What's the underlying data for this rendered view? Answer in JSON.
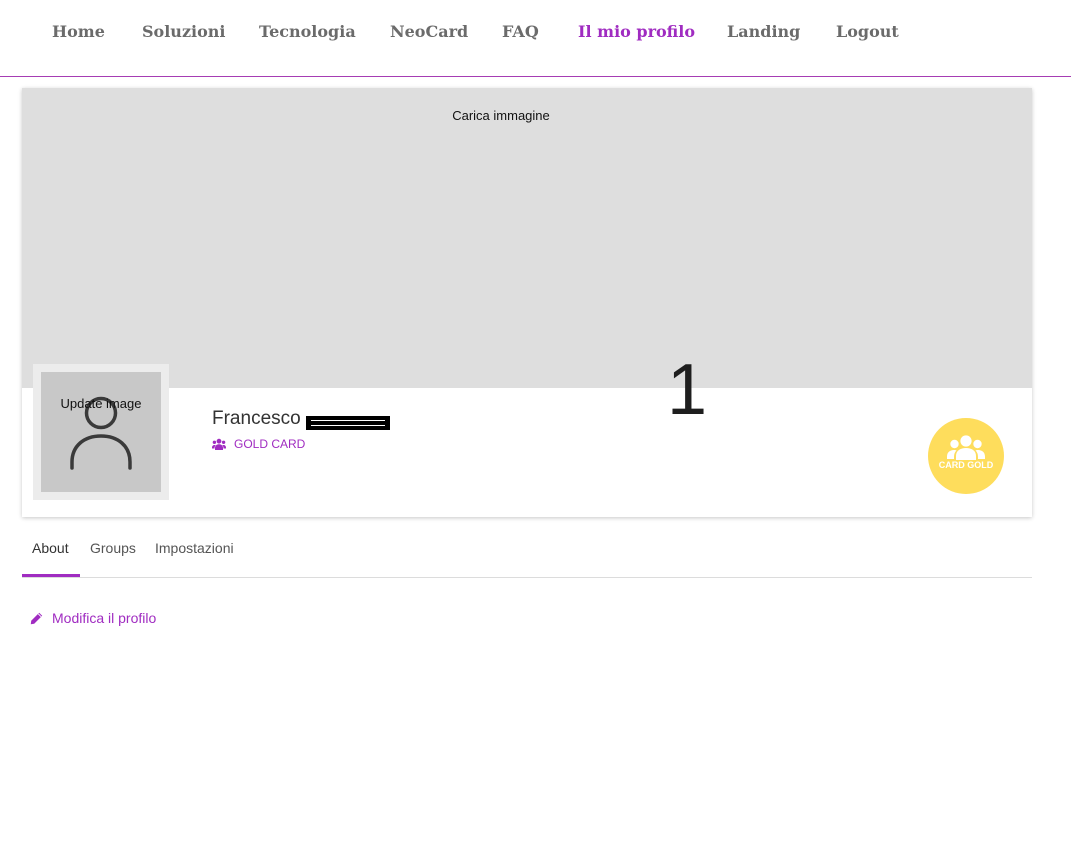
{
  "nav": {
    "items": [
      {
        "label": "Home"
      },
      {
        "label": "Soluzioni"
      },
      {
        "label": "Tecnologia"
      },
      {
        "label": "NeoCard"
      },
      {
        "label": "FAQ"
      },
      {
        "label": "Il mio profilo",
        "active": true
      },
      {
        "label": "Landing"
      },
      {
        "label": "Logout"
      }
    ]
  },
  "profile": {
    "cover_upload_label": "Carica immagine",
    "counter": "1",
    "avatar_update_label": "Update image",
    "avatar_icon": "user-icon",
    "name": "Francesco",
    "name_redacted": true,
    "card_level_icon": "users-icon",
    "card_level": "GOLD CARD",
    "badge": {
      "icon": "users-icon",
      "label": "CARD GOLD",
      "color": "#fedd5c"
    }
  },
  "tabs": [
    {
      "label": "About",
      "active": true
    },
    {
      "label": "Groups"
    },
    {
      "label": "Impostazioni"
    }
  ],
  "actions": {
    "edit_icon": "pencil-icon",
    "edit_profile_label": "Modifica il profilo"
  },
  "theme": {
    "accent": "#a02cc1",
    "nav_text": "#6b6b6b",
    "cover_bg": "#dedede",
    "avatar_bg": "#c8c8c8"
  }
}
